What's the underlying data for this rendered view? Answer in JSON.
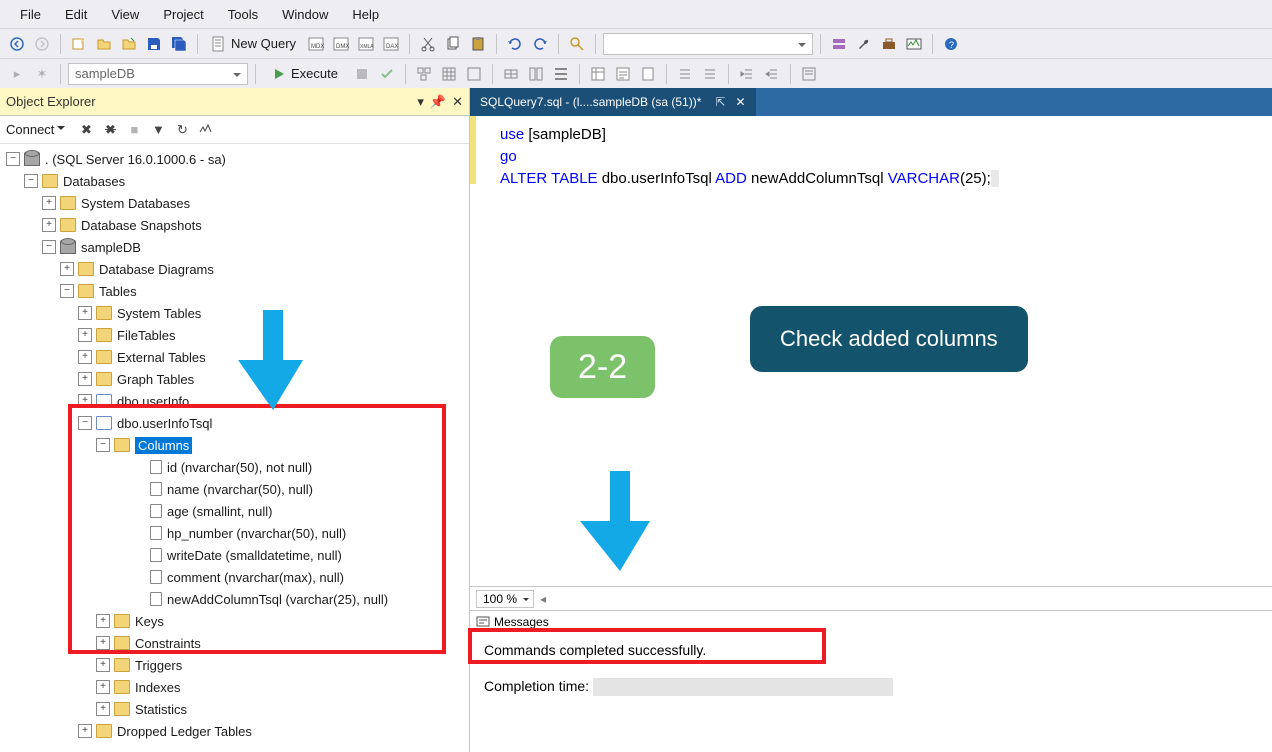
{
  "menu": {
    "items": [
      "File",
      "Edit",
      "View",
      "Project",
      "Tools",
      "Window",
      "Help"
    ]
  },
  "toolbar1": {
    "new_query": "New Query"
  },
  "toolbar2": {
    "db_selector": "sampleDB",
    "execute": "Execute"
  },
  "quicklaunch_placeholder": "",
  "object_explorer": {
    "title": "Object Explorer",
    "connect": "Connect",
    "server": ". (SQL Server 16.0.1000.6 - sa)",
    "nodes": {
      "databases": "Databases",
      "sys_db": "System Databases",
      "snapshots": "Database Snapshots",
      "sampledb": "sampleDB",
      "diagrams": "Database Diagrams",
      "tables": "Tables",
      "sys_tables": "System Tables",
      "filetables": "FileTables",
      "external": "External Tables",
      "graph": "Graph Tables",
      "userinfo": "dbo.userInfo",
      "userinfo_tsql": "dbo.userInfoTsql",
      "columns": "Columns",
      "keys": "Keys",
      "constraints": "Constraints",
      "triggers": "Triggers",
      "indexes": "Indexes",
      "statistics": "Statistics",
      "dropped": "Dropped Ledger Tables"
    },
    "columns": [
      "id (nvarchar(50), not null)",
      "name (nvarchar(50), null)",
      "age (smallint, null)",
      "hp_number (nvarchar(50), null)",
      "writeDate (smalldatetime, null)",
      "comment (nvarchar(max), null)",
      "newAddColumnTsql (varchar(25), null)"
    ]
  },
  "editor": {
    "tab_title": "SQLQuery7.sql - (l....sampleDB (sa (51))*",
    "code": {
      "l1_use": "use ",
      "l1_db": "[sampleDB]",
      "l2_go": "go",
      "l3_alter": "ALTER ",
      "l3_table": "TABLE ",
      "l3_obj": "dbo.userInfoTsql ",
      "l3_add": "ADD ",
      "l3_col": "newAddColumnTsql ",
      "l3_type": "VARCHAR",
      "l3_size": "(25);"
    },
    "zoom": "100 %"
  },
  "messages": {
    "tab": "Messages",
    "ok": "Commands completed successfully.",
    "time_label": "Completion time:"
  },
  "annotations": {
    "badge": "2-2",
    "callout": "Check added columns"
  }
}
